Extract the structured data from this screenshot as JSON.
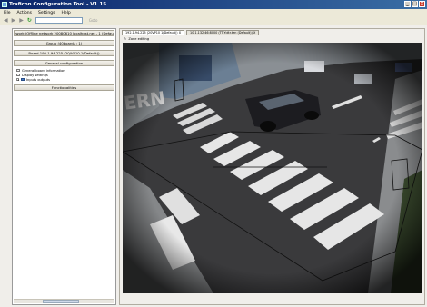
{
  "window": {
    "title": "Traficon Configuration Tool - V1.15"
  },
  "menu": {
    "items": [
      "File",
      "Actions",
      "Settings",
      "Help"
    ]
  },
  "toolbar": {
    "goto_label": "Goto"
  },
  "left": {
    "network": "Network (Offline network 20080610 localhost.net - 1 (Default))",
    "group": "Group (40boards : 1)",
    "board": "Board 192.1.94.225 (20/VP10 1(Default))",
    "general_config": "General configuration",
    "tree": [
      "General board information",
      "Display settings",
      "Inputs outputs"
    ],
    "functionalities": "Functionalities"
  },
  "right": {
    "tabs": [
      "192.1.94.225 (20VP10 1(Default)) X",
      "10.1.132.46:8000 (TT.Y:dtr.ten (Default)) X"
    ],
    "zone_editing": "Zone editing"
  },
  "colors": {
    "title_start": "#0a246a",
    "title_end": "#3a6ea5",
    "panel_bg": "#ece9d8"
  },
  "icons": [
    "app-icon",
    "back-icon",
    "forward-icon",
    "refresh-icon",
    "pencil-icon"
  ]
}
